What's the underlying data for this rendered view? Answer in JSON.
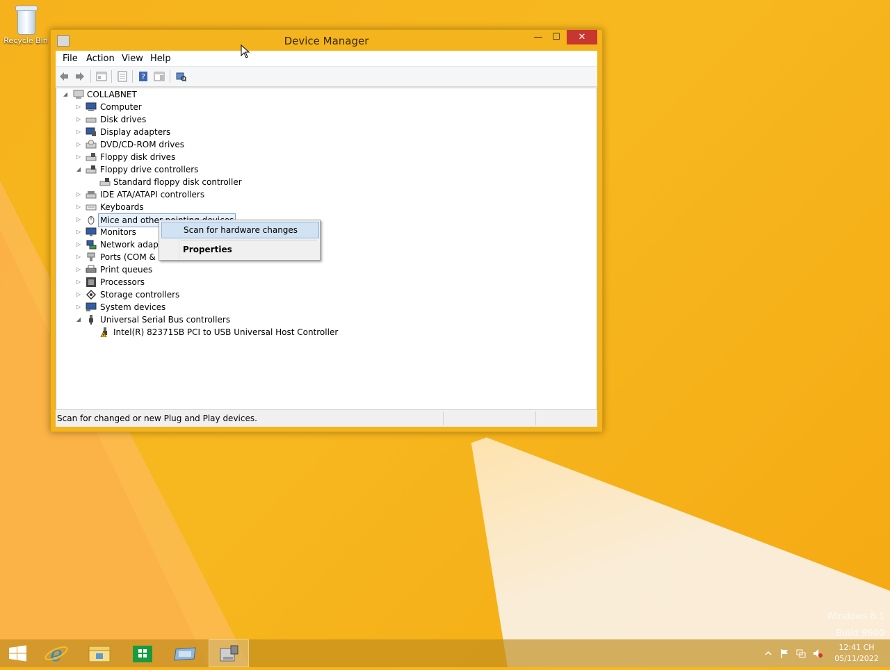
{
  "desktop": {
    "recycle_bin_label": "Recycle Bin",
    "watermark_line1": "Windows 8.1",
    "watermark_line2": "Build 9600"
  },
  "window": {
    "title": "Device Manager",
    "minimize_glyph": "—",
    "maximize_glyph": "☐",
    "close_glyph": "✕",
    "menu": [
      "File",
      "Action",
      "View",
      "Help"
    ],
    "toolbar_icons": [
      "back-icon",
      "forward-icon",
      "show-hide-console-tree-icon",
      "properties-icon",
      "help-icon",
      "show-action-pane-icon",
      "scan-hardware-icon"
    ]
  },
  "tree": {
    "root": "COLLABNET",
    "items": [
      {
        "label": "Computer",
        "icon": "computer-icon",
        "expander": "▷"
      },
      {
        "label": "Disk drives",
        "icon": "disk-drive-icon",
        "expander": "▷"
      },
      {
        "label": "Display adapters",
        "icon": "display-adapter-icon",
        "expander": "▷"
      },
      {
        "label": "DVD/CD-ROM drives",
        "icon": "dvd-drive-icon",
        "expander": "▷"
      },
      {
        "label": "Floppy disk drives",
        "icon": "floppy-drive-icon",
        "expander": "▷"
      },
      {
        "label": "Floppy drive controllers",
        "icon": "floppy-controller-icon",
        "expander": "◢"
      },
      {
        "label": "Standard floppy disk controller",
        "icon": "floppy-controller-icon",
        "child": true
      },
      {
        "label": "IDE ATA/ATAPI controllers",
        "icon": "ide-controller-icon",
        "expander": "▷"
      },
      {
        "label": "Keyboards",
        "icon": "keyboard-icon",
        "expander": "▷"
      },
      {
        "label": "Mice and other pointing devices",
        "icon": "mouse-icon",
        "expander": "▷",
        "selected": true
      },
      {
        "label": "Monitors",
        "icon": "monitor-icon",
        "expander": "▷"
      },
      {
        "label": "Network adapters",
        "icon": "network-adapter-icon",
        "expander": "▷"
      },
      {
        "label": "Ports (COM & LPT)",
        "icon": "port-icon",
        "expander": "▷"
      },
      {
        "label": "Print queues",
        "icon": "printer-icon",
        "expander": "▷"
      },
      {
        "label": "Processors",
        "icon": "processor-icon",
        "expander": "▷"
      },
      {
        "label": "Storage controllers",
        "icon": "storage-controller-icon",
        "expander": "▷"
      },
      {
        "label": "System devices",
        "icon": "system-device-icon",
        "expander": "▷"
      },
      {
        "label": "Universal Serial Bus controllers",
        "icon": "usb-icon",
        "expander": "◢"
      },
      {
        "label": "Intel(R) 82371SB PCI to USB Universal Host Controller",
        "icon": "usb-warning-icon",
        "child": true
      }
    ]
  },
  "context_menu": {
    "items": [
      "Scan for hardware changes",
      "Properties"
    ]
  },
  "status": {
    "text": "Scan for changed or new Plug and Play devices."
  },
  "taskbar": {
    "buttons": [
      "start-button",
      "internet-explorer",
      "file-explorer",
      "store",
      "server-manager",
      "device-manager"
    ],
    "clock_time": "12:41 CH",
    "clock_date": "05/11/2022"
  },
  "colors": {
    "accent": "#f4b41e",
    "close_button": "#c7372f",
    "selection": "#e5f0fb"
  }
}
